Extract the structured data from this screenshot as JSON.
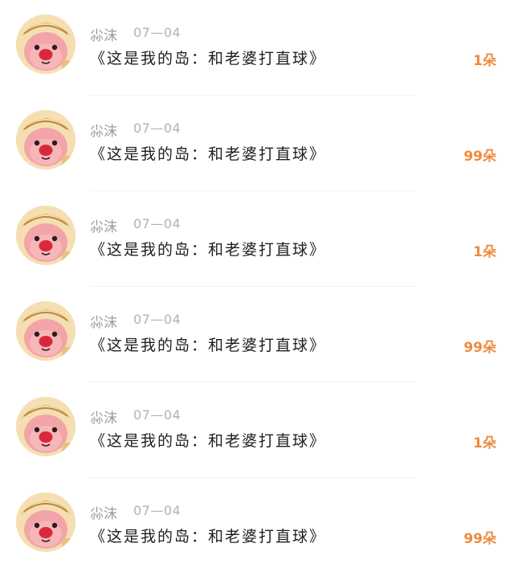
{
  "items": [
    {
      "name": "尛沫",
      "date": "07—04",
      "title": "《这是我的岛：和老婆打直球》",
      "count": "1朵"
    },
    {
      "name": "尛沫",
      "date": "07—04",
      "title": "《这是我的岛：和老婆打直球》",
      "count": "99朵"
    },
    {
      "name": "尛沫",
      "date": "07—04",
      "title": "《这是我的岛：和老婆打直球》",
      "count": "1朵"
    },
    {
      "name": "尛沫",
      "date": "07—04",
      "title": "《这是我的岛：和老婆打直球》",
      "count": "99朵"
    },
    {
      "name": "尛沫",
      "date": "07—04",
      "title": "《这是我的岛：和老婆打直球》",
      "count": "1朵"
    },
    {
      "name": "尛沫",
      "date": "07—04",
      "title": "《这是我的岛：和老婆打直球》",
      "count": "99朵"
    }
  ],
  "colors": {
    "count": "#ef8a3c",
    "name": "#9a9a9a",
    "title": "#1f1f1f"
  },
  "icons": {
    "avatar": "cartoon-helmet-character-avatar"
  }
}
